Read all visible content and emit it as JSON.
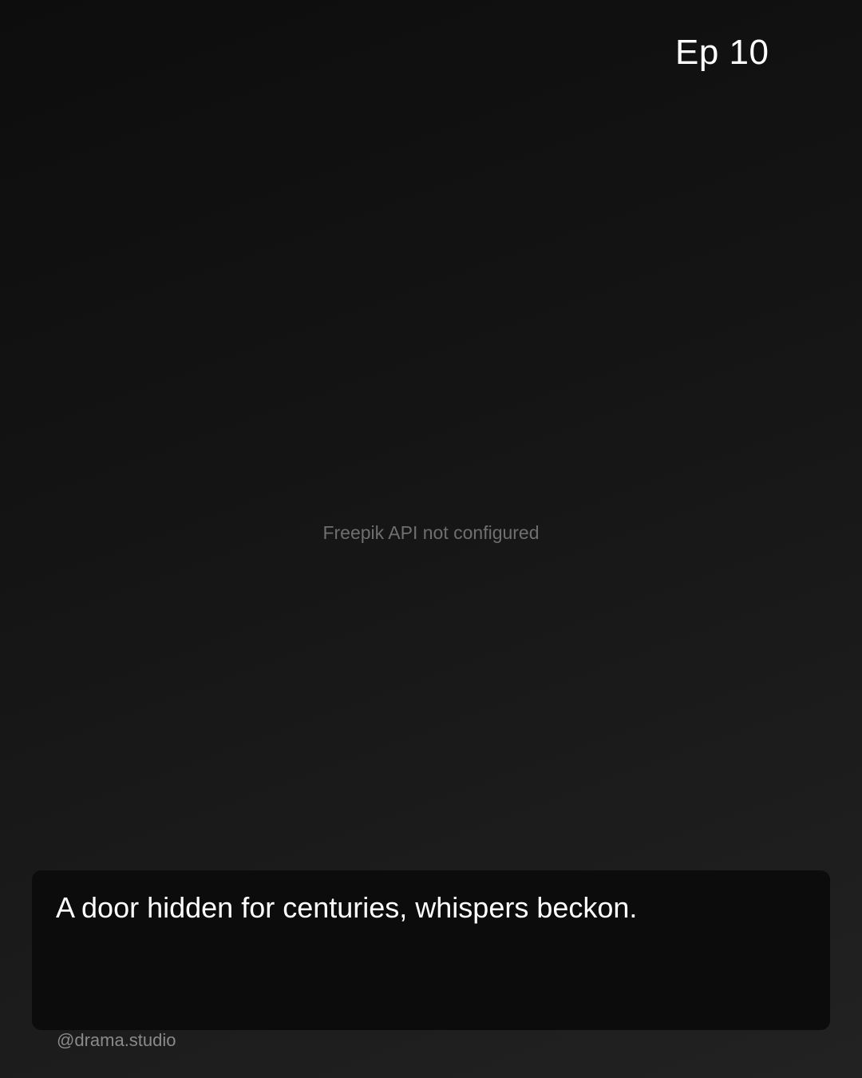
{
  "episode": {
    "label": "Ep 10"
  },
  "media": {
    "placeholder": "Freepik API not configured"
  },
  "caption": {
    "text": "A door hidden for centuries, whispers beckon."
  },
  "footer": {
    "handle": "@drama.studio"
  }
}
